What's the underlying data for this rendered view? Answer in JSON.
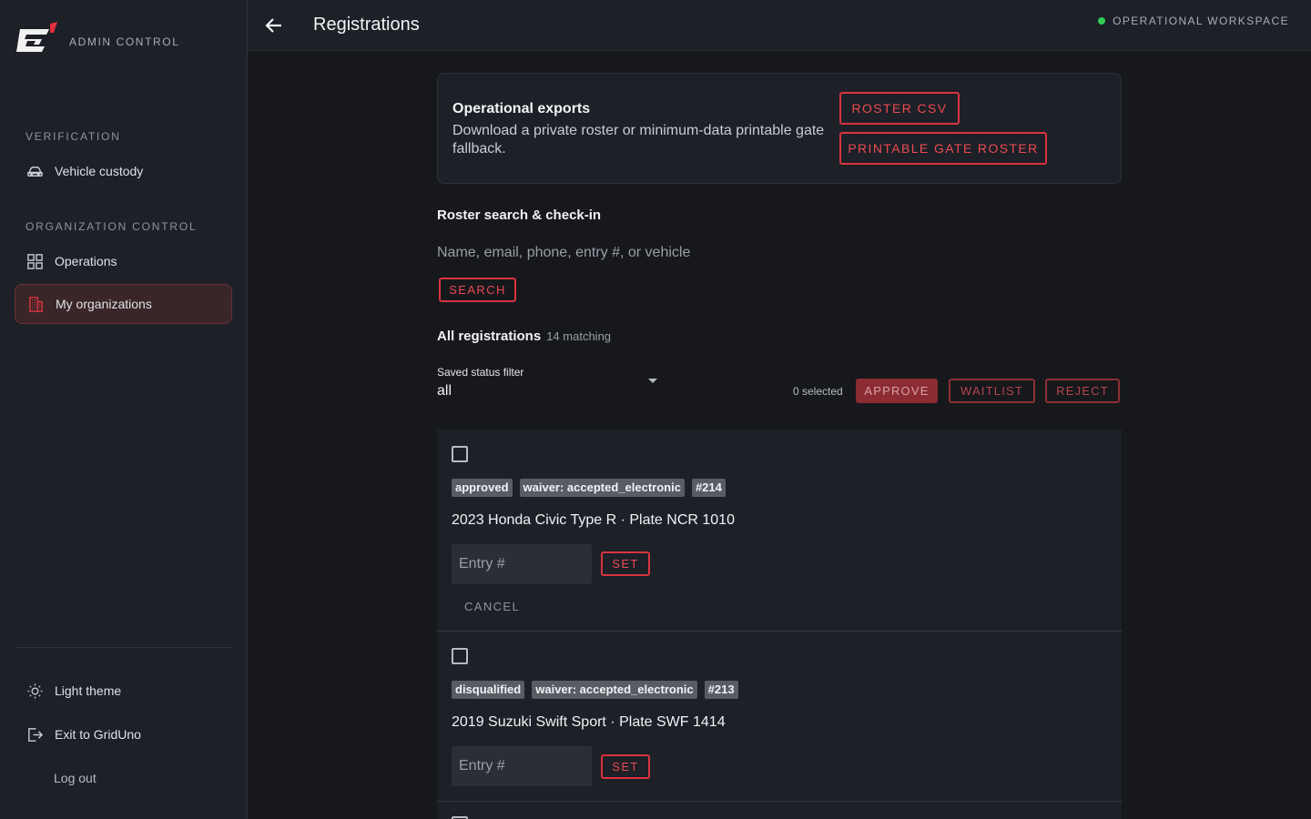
{
  "app": {
    "brand_label": "ADMIN CONTROL"
  },
  "sidebar": {
    "sections": [
      {
        "label": "VERIFICATION",
        "items": [
          {
            "label": "Vehicle custody",
            "icon": "car-icon"
          }
        ]
      },
      {
        "label": "ORGANIZATION CONTROL",
        "items": [
          {
            "label": "Operations",
            "icon": "grid-icon"
          },
          {
            "label": "My organizations",
            "icon": "building-icon",
            "active": true
          }
        ]
      }
    ],
    "footer": {
      "theme_label": "Light theme",
      "exit_label": "Exit to GridUno",
      "logout_label": "Log out"
    }
  },
  "header": {
    "title": "Registrations",
    "workspace": "OPERATIONAL WORKSPACE",
    "status_color": "#2ecc55"
  },
  "exports": {
    "title": "Operational exports",
    "description": "Download a private roster or minimum-data printable gate fallback.",
    "roster_csv_label": "ROSTER CSV",
    "gate_roster_label": "PRINTABLE GATE ROSTER"
  },
  "search": {
    "title": "Roster search & check-in",
    "placeholder": "Name, email, phone, entry #, or vehicle",
    "button_label": "SEARCH"
  },
  "registrations": {
    "title": "All registrations",
    "count": "14 matching",
    "filter_label": "Saved status filter",
    "filter_value": "all",
    "selected": "0 selected",
    "approve_label": "APPROVE",
    "waitlist_label": "WAITLIST",
    "reject_label": "REJECT",
    "items": [
      {
        "status": "approved",
        "waiver": "waiver: accepted_electronic",
        "entry": "#214",
        "vehicle": "2023 Honda Civic Type R · Plate NCR 1010",
        "entry_placeholder": "Entry #",
        "set_label": "SET",
        "cancel_label": "CANCEL"
      },
      {
        "status": "disqualified",
        "waiver": "waiver: accepted_electronic",
        "entry": "#213",
        "vehicle": "2019 Suzuki Swift Sport · Plate SWF 1414",
        "entry_placeholder": "Entry #",
        "set_label": "SET"
      }
    ]
  },
  "colors": {
    "accent": "#d9343f",
    "background": "#16181c",
    "panel": "#1d2027"
  }
}
